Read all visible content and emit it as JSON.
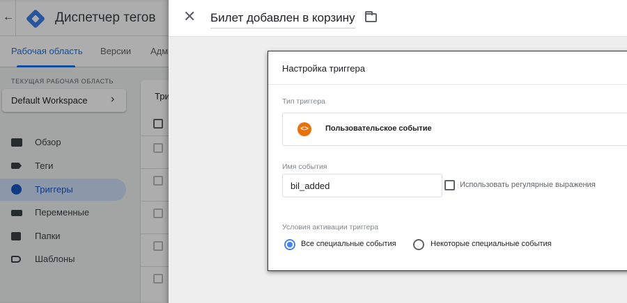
{
  "app": {
    "title": "Диспетчер тегов",
    "tabs": [
      "Рабочая область",
      "Версии",
      "Администрирование"
    ],
    "workspace_label": "ТЕКУЩАЯ РАБОЧАЯ ОБЛАСТЬ",
    "workspace": "Default Workspace",
    "nav": [
      {
        "label": "Обзор",
        "icon": "overview-icon"
      },
      {
        "label": "Теги",
        "icon": "tag-icon"
      },
      {
        "label": "Триггеры",
        "icon": "trigger-icon",
        "active": true
      },
      {
        "label": "Переменные",
        "icon": "variables-icon"
      },
      {
        "label": "Папки",
        "icon": "folder-icon"
      },
      {
        "label": "Шаблоны",
        "icon": "template-icon"
      }
    ],
    "list_header": "Триггеры"
  },
  "panel": {
    "title": "Билет добавлен в корзину",
    "card_title": "Настройка триггера",
    "type_label": "Тип триггера",
    "type_value": "Пользовательское событие",
    "event_label": "Имя события",
    "event_value": "bil_added",
    "regex_label": "Использовать регулярные выражения",
    "regex_checked": false,
    "conditions_label": "Условия активации триггера",
    "radio_all": "Все специальные события",
    "radio_some": "Некоторые специальные события",
    "selected": "all",
    "accent": "#4285f4",
    "type_icon_color": "#e8710a"
  }
}
